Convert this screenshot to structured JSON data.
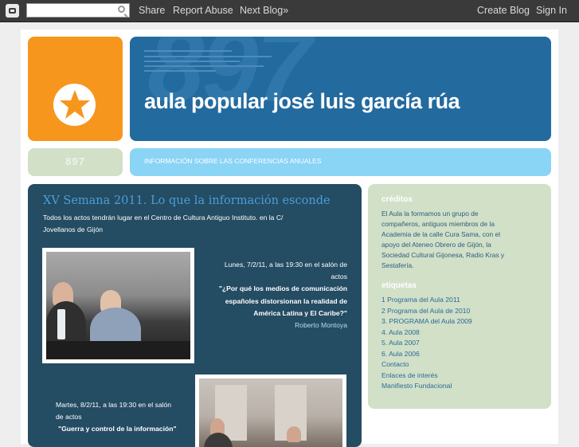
{
  "navbar": {
    "search_placeholder": "",
    "share": "Share",
    "report_abuse": "Report Abuse",
    "next_blog": "Next Blog»",
    "create_blog": "Create Blog",
    "sign_in": "Sign In"
  },
  "header": {
    "background_number": "897",
    "title": "aula popular josé luis garcía rúa",
    "side_number": "897",
    "description": "INFORMACIÓN SOBRE LAS CONFERENCIAS ANUALES"
  },
  "post": {
    "title": "XV Semana 2011. Lo que la información esconde",
    "intro_line1": "Todos los actos tendrán lugar en el Centro de Cultura Antiguo Instituto. en la C/",
    "intro_line2": "Jovellanos de Gijón",
    "event1": {
      "date_line1": "Lunes, 7/2/11, a las 19:30 en el salón de",
      "date_line2": "actos",
      "title_line1": "\"¿Por qué los medios de comunicación",
      "title_line2": "españoles distorsionan la realidad de",
      "title_line3": "América Latina y El Caribe?\"",
      "speaker": "Roberto Montoya"
    },
    "event2": {
      "date_line1": "Martes, 8/2/11, a las 19:30 en el salón",
      "date_line2": "de actos",
      "title_line1": "\"Guerra y control de la información\""
    }
  },
  "sidebar": {
    "creditos_heading": "créditos",
    "creditos_lines": [
      "El Aula la formamos un grupo de",
      "compañeros, antiguos miembros de la",
      "Academia de la calle Cura Sama, con el",
      "apoyo del Ateneo Obrero de Gijón, la",
      "Sociedad Cultural Gijonesa, Radio Kras y",
      "Sestafería."
    ],
    "etiquetas_heading": "etiquetas",
    "labels": [
      "1 Programa del Aula 2011",
      "2 Programa del Aula de 2010",
      "3. PROGRAMA del Aula 2009",
      "4. Aula 2008",
      "5. Aula 2007",
      "6. Aula 2006",
      "Contacto",
      "Enlaces de interés",
      "Manifiesto Fundacional"
    ]
  },
  "colors": {
    "orange": "#f7961d",
    "header_blue": "#236a9e",
    "light_blue": "#8ad4f5",
    "post_bg": "#244c63",
    "sidebar_bg": "#d1e0c7",
    "post_title": "#4a9ed8"
  }
}
